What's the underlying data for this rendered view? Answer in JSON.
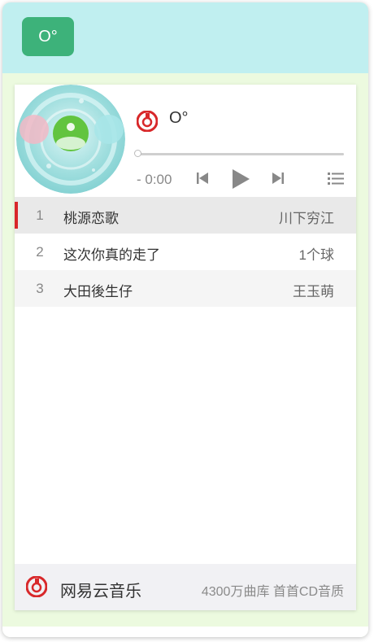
{
  "header": {
    "avatar_text": "O°",
    "background": "#c0eff0",
    "button_color": "#3db27a"
  },
  "player": {
    "song_title": "O°",
    "time": "- 0:00",
    "progress": 0,
    "controls": [
      "prev-icon",
      "play-icon",
      "next-icon",
      "playlist-icon"
    ]
  },
  "playlist": [
    {
      "num": "1",
      "name": "桃源恋歌",
      "artist": "川下穷江"
    },
    {
      "num": "2",
      "name": "这次你真的走了",
      "artist": "1个球"
    },
    {
      "num": "3",
      "name": "大田後生仔",
      "artist": "王玉萌"
    }
  ],
  "footer": {
    "brand": "网易云音乐",
    "slogan": "4300万曲库 首首CD音质"
  },
  "colors": {
    "accent": "#d8282a",
    "card_bg": "#ecfadf"
  }
}
